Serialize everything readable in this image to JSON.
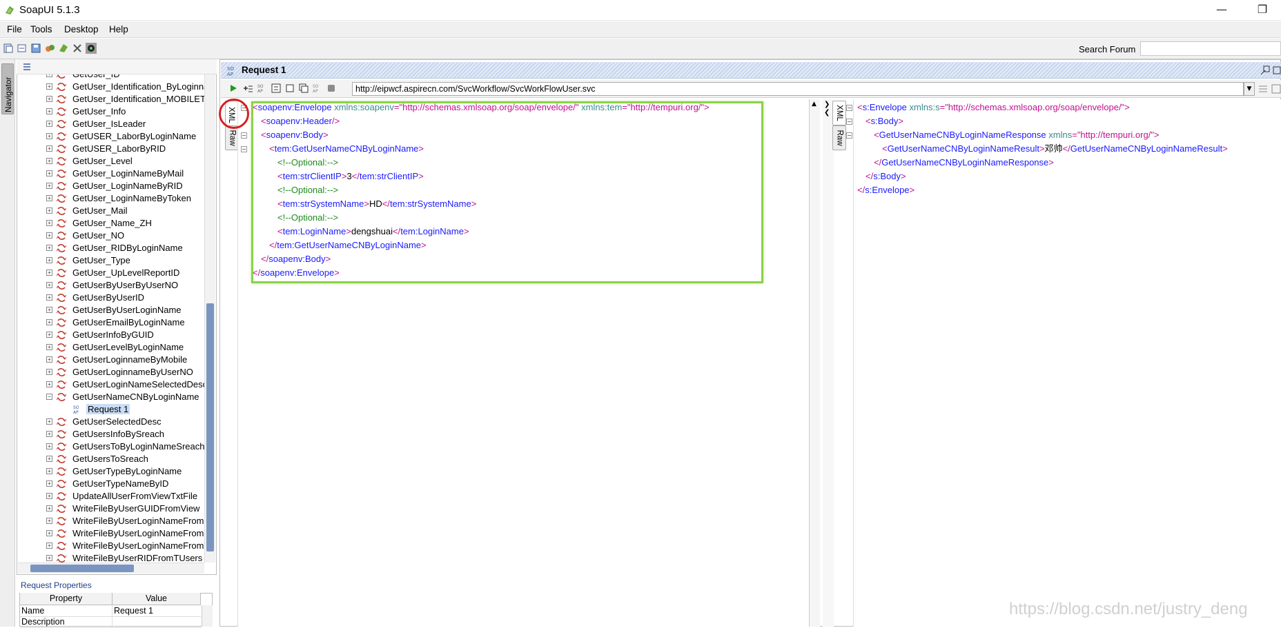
{
  "window": {
    "title": "SoapUI 5.1.3",
    "minimize": "—",
    "restore": "❐"
  },
  "menu": [
    {
      "label": "File"
    },
    {
      "label": "Tools"
    },
    {
      "label": "Desktop"
    },
    {
      "label": "Help"
    }
  ],
  "toolbar": {
    "search_label": "Search Forum",
    "search_value": ""
  },
  "navigator": {
    "label": "Navigator"
  },
  "tree": {
    "items": [
      {
        "label": "GetUser_ID",
        "child": false
      },
      {
        "label": "GetUser_Identification_ByLoginname",
        "child": false
      },
      {
        "label": "GetUser_Identification_MOBILETEL",
        "child": false
      },
      {
        "label": "GetUser_Info",
        "child": false
      },
      {
        "label": "GetUser_IsLeader",
        "child": false
      },
      {
        "label": "GetUSER_LaborByLoginName",
        "child": false
      },
      {
        "label": "GetUSER_LaborByRID",
        "child": false
      },
      {
        "label": "GetUser_Level",
        "child": false
      },
      {
        "label": "GetUser_LoginNameByMail",
        "child": false
      },
      {
        "label": "GetUser_LoginNameByRID",
        "child": false
      },
      {
        "label": "GetUser_LoginNameByToken",
        "child": false
      },
      {
        "label": "GetUser_Mail",
        "child": false
      },
      {
        "label": "GetUser_Name_ZH",
        "child": false
      },
      {
        "label": "GetUser_NO",
        "child": false
      },
      {
        "label": "GetUser_RIDByLoginName",
        "child": false
      },
      {
        "label": "GetUser_Type",
        "child": false
      },
      {
        "label": "GetUser_UpLevelReportID",
        "child": false
      },
      {
        "label": "GetUserByUserByUserNO",
        "child": false
      },
      {
        "label": "GetUserByUserID",
        "child": false
      },
      {
        "label": "GetUserByUserLoginName",
        "child": false
      },
      {
        "label": "GetUserEmailByLoginName",
        "child": false
      },
      {
        "label": "GetUserInfoByGUID",
        "child": false
      },
      {
        "label": "GetUserLevelByLoginName",
        "child": false
      },
      {
        "label": "GetUserLoginnameByMobile",
        "child": false
      },
      {
        "label": "GetUserLoginnameByUserNO",
        "child": false
      },
      {
        "label": "GetUserLoginNameSelectedDesc",
        "child": false
      },
      {
        "label": "GetUserNameCNByLoginName",
        "child": false,
        "expanded": true
      },
      {
        "label": "Request 1",
        "child": true
      },
      {
        "label": "GetUserSelectedDesc",
        "child": false
      },
      {
        "label": "GetUsersInfoBySreach",
        "child": false
      },
      {
        "label": "GetUsersToByLoginNameSreach",
        "child": false
      },
      {
        "label": "GetUsersToSreach",
        "child": false
      },
      {
        "label": "GetUserTypeByLoginName",
        "child": false
      },
      {
        "label": "GetUserTypeNameByID",
        "child": false
      },
      {
        "label": "UpdateAllUserFromViewTxtFile",
        "child": false
      },
      {
        "label": "WriteFileByUserGUIDFromView",
        "child": false
      },
      {
        "label": "WriteFileByUserLoginNameFromG",
        "child": false
      },
      {
        "label": "WriteFileByUserLoginNameFromT",
        "child": false
      },
      {
        "label": "WriteFileByUserLoginNameFromV",
        "child": false
      },
      {
        "label": "WriteFileByUserRIDFromTUsers",
        "child": false
      }
    ]
  },
  "properties": {
    "title": "Request Properties",
    "col_property": "Property",
    "col_value": "Value",
    "rows": [
      {
        "name": "Name",
        "value": "Request 1"
      },
      {
        "name": "Description",
        "value": ""
      }
    ]
  },
  "request": {
    "title": "Request 1",
    "endpoint": "http://eipwcf.aspirecn.com/SvcWorkflow/SvcWorkFlowUser.svc",
    "tab_xml": "XML",
    "tab_raw": "Raw",
    "xml_lines": [
      {
        "indent": 0,
        "parts": [
          [
            "punc",
            "<"
          ],
          [
            "tag",
            "soapenv:Envelope"
          ],
          [
            "attrn",
            " xmlns:soapenv"
          ],
          [
            "punc",
            "="
          ],
          [
            "attrv",
            "\"http://schemas.xmlsoap.org/soap/envelope/\""
          ],
          [
            "attrn",
            " xmlns:tem"
          ],
          [
            "punc",
            "="
          ],
          [
            "attrv",
            "\"http://tempuri.org/\""
          ],
          [
            "punc",
            ">"
          ]
        ]
      },
      {
        "indent": 1,
        "parts": [
          [
            "punc",
            "<"
          ],
          [
            "tag",
            "soapenv:Header"
          ],
          [
            "punc",
            "/>"
          ]
        ]
      },
      {
        "indent": 1,
        "parts": [
          [
            "punc",
            "<"
          ],
          [
            "tag",
            "soapenv:Body"
          ],
          [
            "punc",
            ">"
          ]
        ]
      },
      {
        "indent": 2,
        "parts": [
          [
            "punc",
            "<"
          ],
          [
            "tag",
            "tem:GetUserNameCNByLoginName"
          ],
          [
            "punc",
            ">"
          ]
        ]
      },
      {
        "indent": 3,
        "parts": [
          [
            "comment",
            "<!--Optional:-->"
          ]
        ]
      },
      {
        "indent": 3,
        "parts": [
          [
            "punc",
            "<"
          ],
          [
            "tag",
            "tem:strClientIP"
          ],
          [
            "punc",
            ">"
          ],
          [
            "txt",
            "3"
          ],
          [
            "punc",
            "</"
          ],
          [
            "tag",
            "tem:strClientIP"
          ],
          [
            "punc",
            ">"
          ]
        ]
      },
      {
        "indent": 3,
        "parts": [
          [
            "comment",
            "<!--Optional:-->"
          ]
        ]
      },
      {
        "indent": 3,
        "parts": [
          [
            "punc",
            "<"
          ],
          [
            "tag",
            "tem:strSystemName"
          ],
          [
            "punc",
            ">"
          ],
          [
            "txt",
            "HD"
          ],
          [
            "punc",
            "</"
          ],
          [
            "tag",
            "tem:strSystemName"
          ],
          [
            "punc",
            ">"
          ]
        ]
      },
      {
        "indent": 3,
        "parts": [
          [
            "comment",
            "<!--Optional:-->"
          ]
        ]
      },
      {
        "indent": 3,
        "parts": [
          [
            "punc",
            "<"
          ],
          [
            "tag",
            "tem:LoginName"
          ],
          [
            "punc",
            ">"
          ],
          [
            "txt",
            "dengshuai"
          ],
          [
            "punc",
            "</"
          ],
          [
            "tag",
            "tem:LoginName"
          ],
          [
            "punc",
            ">"
          ]
        ]
      },
      {
        "indent": 2,
        "parts": [
          [
            "punc",
            "</"
          ],
          [
            "tag",
            "tem:GetUserNameCNByLoginName"
          ],
          [
            "punc",
            ">"
          ]
        ]
      },
      {
        "indent": 1,
        "parts": [
          [
            "punc",
            "</"
          ],
          [
            "tag",
            "soapenv:Body"
          ],
          [
            "punc",
            ">"
          ]
        ]
      },
      {
        "indent": 0,
        "parts": [
          [
            "punc",
            "</"
          ],
          [
            "tag",
            "soapenv:Envelope"
          ],
          [
            "punc",
            ">"
          ]
        ]
      }
    ]
  },
  "response": {
    "tab_xml": "XML",
    "tab_raw": "Raw",
    "xml_lines": [
      {
        "indent": 0,
        "parts": [
          [
            "punc",
            "<"
          ],
          [
            "tag",
            "s:Envelope"
          ],
          [
            "attrn",
            " xmlns:s"
          ],
          [
            "punc",
            "="
          ],
          [
            "attrv",
            "\"http://schemas.xmlsoap.org/soap/envelope/\""
          ],
          [
            "punc",
            ">"
          ]
        ]
      },
      {
        "indent": 1,
        "parts": [
          [
            "punc",
            "<"
          ],
          [
            "tag",
            "s:Body"
          ],
          [
            "punc",
            ">"
          ]
        ]
      },
      {
        "indent": 2,
        "parts": [
          [
            "punc",
            "<"
          ],
          [
            "tag",
            "GetUserNameCNByLoginNameResponse"
          ],
          [
            "attrn",
            " xmlns"
          ],
          [
            "punc",
            "="
          ],
          [
            "attrv",
            "\"http://tempuri.org/\""
          ],
          [
            "punc",
            ">"
          ]
        ]
      },
      {
        "indent": 3,
        "parts": [
          [
            "punc",
            "<"
          ],
          [
            "tag",
            "GetUserNameCNByLoginNameResult"
          ],
          [
            "punc",
            ">"
          ],
          [
            "txt",
            "邓帅"
          ],
          [
            "punc",
            "</"
          ],
          [
            "tag",
            "GetUserNameCNByLoginNameResult"
          ],
          [
            "punc",
            ">"
          ]
        ]
      },
      {
        "indent": 2,
        "parts": [
          [
            "punc",
            "</"
          ],
          [
            "tag",
            "GetUserNameCNByLoginNameResponse"
          ],
          [
            "punc",
            ">"
          ]
        ]
      },
      {
        "indent": 1,
        "parts": [
          [
            "punc",
            "</"
          ],
          [
            "tag",
            "s:Body"
          ],
          [
            "punc",
            ">"
          ]
        ]
      },
      {
        "indent": 0,
        "parts": [
          [
            "punc",
            "</"
          ],
          [
            "tag",
            "s:Envelope"
          ],
          [
            "punc",
            ">"
          ]
        ]
      }
    ]
  },
  "watermark": "https://blog.csdn.net/justry_deng"
}
